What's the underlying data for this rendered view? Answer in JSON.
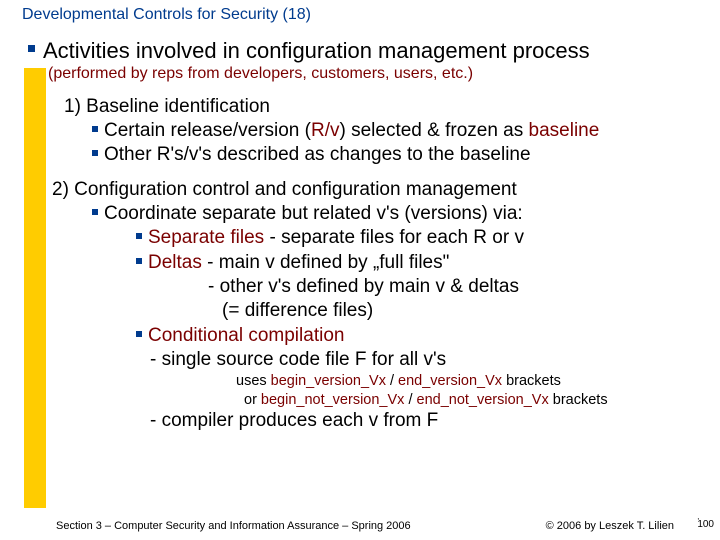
{
  "title": "Developmental Controls for Security (18)",
  "main": {
    "heading": "Activities involved in configuration management process",
    "desc": "(performed by reps from developers, customers, users, etc.)"
  },
  "item1": {
    "num": "1) Baseline identification",
    "b1a": "Certain release/version (",
    "b1rv": "R/v",
    "b1b": ") selected & frozen as ",
    "b1c": "baseline",
    "b2a": "Other R's/v's described as changes to the baseline"
  },
  "item2": {
    "num": "2) Configuration control and configuration management",
    "c1": "Coordinate separate but related v's (versions) via:",
    "sep_a": "Separate files",
    "sep_b": " - separate files for each R or v",
    "del_a": "Deltas",
    "del_b": " - main v defined by „full files\"",
    "del_c": "- other v's defined by main v & deltas",
    "del_d": "(= difference files)",
    "cc_a": "Conditional compilation",
    "cc_b": "- single source code file F for all v's",
    "note1a": "uses ",
    "note1b": "begin_version_Vx",
    "note1c": " / ",
    "note1d": "end_version_Vx",
    "note1e": " brackets",
    "note2a": "or    ",
    "note2b": "begin_not_version_Vx",
    "note2c": " / ",
    "note2d": "end_not_version_Vx",
    "note2e": " brackets",
    "cc_c": "- compiler produces each v from F"
  },
  "footer": {
    "left": "Section 3 – Computer Security and Information Assurance – Spring 2006",
    "right": "© 2006 by Leszek T. Lilien",
    "page": "100",
    "tick": "'"
  }
}
